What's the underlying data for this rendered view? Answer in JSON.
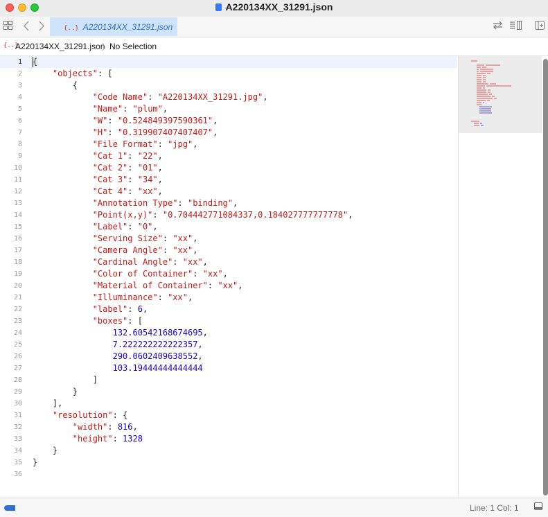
{
  "window": {
    "title": "A220134XX_31291.json"
  },
  "toolbar": {
    "grid_icon": "grid-icon",
    "back_icon": "chevron-left-icon",
    "forward_icon": "chevron-right-icon",
    "right_icons": [
      "swap-icon",
      "list-icon",
      "add-editor-icon"
    ]
  },
  "tabs": [
    {
      "badge": "{..}",
      "label": "A220134XX_31291.json",
      "active": true
    }
  ],
  "jumpbar": {
    "badge": "{..}",
    "file": "A220134XX_31291.json",
    "separator": "〉",
    "selection": "No Selection"
  },
  "editor": {
    "lines": [
      [
        [
          "p",
          "{"
        ]
      ],
      [
        [
          "p",
          "    "
        ],
        [
          "k",
          "\"objects\""
        ],
        [
          "p",
          ": ["
        ]
      ],
      [
        [
          "p",
          "        {"
        ]
      ],
      [
        [
          "p",
          "            "
        ],
        [
          "k",
          "\"Code Name\""
        ],
        [
          "p",
          ": "
        ],
        [
          "s",
          "\"A220134XX_31291.jpg\""
        ],
        [
          "p",
          ","
        ]
      ],
      [
        [
          "p",
          "            "
        ],
        [
          "k",
          "\"Name\""
        ],
        [
          "p",
          ": "
        ],
        [
          "s",
          "\"plum\""
        ],
        [
          "p",
          ","
        ]
      ],
      [
        [
          "p",
          "            "
        ],
        [
          "k",
          "\"W\""
        ],
        [
          "p",
          ": "
        ],
        [
          "s",
          "\"0.524849397590361\""
        ],
        [
          "p",
          ","
        ]
      ],
      [
        [
          "p",
          "            "
        ],
        [
          "k",
          "\"H\""
        ],
        [
          "p",
          ": "
        ],
        [
          "s",
          "\"0.319907407407407\""
        ],
        [
          "p",
          ","
        ]
      ],
      [
        [
          "p",
          "            "
        ],
        [
          "k",
          "\"File Format\""
        ],
        [
          "p",
          ": "
        ],
        [
          "s",
          "\"jpg\""
        ],
        [
          "p",
          ","
        ]
      ],
      [
        [
          "p",
          "            "
        ],
        [
          "k",
          "\"Cat 1\""
        ],
        [
          "p",
          ": "
        ],
        [
          "s",
          "\"22\""
        ],
        [
          "p",
          ","
        ]
      ],
      [
        [
          "p",
          "            "
        ],
        [
          "k",
          "\"Cat 2\""
        ],
        [
          "p",
          ": "
        ],
        [
          "s",
          "\"01\""
        ],
        [
          "p",
          ","
        ]
      ],
      [
        [
          "p",
          "            "
        ],
        [
          "k",
          "\"Cat 3\""
        ],
        [
          "p",
          ": "
        ],
        [
          "s",
          "\"34\""
        ],
        [
          "p",
          ","
        ]
      ],
      [
        [
          "p",
          "            "
        ],
        [
          "k",
          "\"Cat 4\""
        ],
        [
          "p",
          ": "
        ],
        [
          "s",
          "\"xx\""
        ],
        [
          "p",
          ","
        ]
      ],
      [
        [
          "p",
          "            "
        ],
        [
          "k",
          "\"Annotation Type\""
        ],
        [
          "p",
          ": "
        ],
        [
          "s",
          "\"binding\""
        ],
        [
          "p",
          ","
        ]
      ],
      [
        [
          "p",
          "            "
        ],
        [
          "k",
          "\"Point(x,y)\""
        ],
        [
          "p",
          ": "
        ],
        [
          "s",
          "\"0.704442771084337,0.184027777777778\""
        ],
        [
          "p",
          ","
        ]
      ],
      [
        [
          "p",
          "            "
        ],
        [
          "k",
          "\"Label\""
        ],
        [
          "p",
          ": "
        ],
        [
          "s",
          "\"0\""
        ],
        [
          "p",
          ","
        ]
      ],
      [
        [
          "p",
          "            "
        ],
        [
          "k",
          "\"Serving Size\""
        ],
        [
          "p",
          ": "
        ],
        [
          "s",
          "\"xx\""
        ],
        [
          "p",
          ","
        ]
      ],
      [
        [
          "p",
          "            "
        ],
        [
          "k",
          "\"Camera Angle\""
        ],
        [
          "p",
          ": "
        ],
        [
          "s",
          "\"xx\""
        ],
        [
          "p",
          ","
        ]
      ],
      [
        [
          "p",
          "            "
        ],
        [
          "k",
          "\"Cardinal Angle\""
        ],
        [
          "p",
          ": "
        ],
        [
          "s",
          "\"xx\""
        ],
        [
          "p",
          ","
        ]
      ],
      [
        [
          "p",
          "            "
        ],
        [
          "k",
          "\"Color of Container\""
        ],
        [
          "p",
          ": "
        ],
        [
          "s",
          "\"xx\""
        ],
        [
          "p",
          ","
        ]
      ],
      [
        [
          "p",
          "            "
        ],
        [
          "k",
          "\"Material of Container\""
        ],
        [
          "p",
          ": "
        ],
        [
          "s",
          "\"xx\""
        ],
        [
          "p",
          ","
        ]
      ],
      [
        [
          "p",
          "            "
        ],
        [
          "k",
          "\"Illuminance\""
        ],
        [
          "p",
          ": "
        ],
        [
          "s",
          "\"xx\""
        ],
        [
          "p",
          ","
        ]
      ],
      [
        [
          "p",
          "            "
        ],
        [
          "k",
          "\"label\""
        ],
        [
          "p",
          ": "
        ],
        [
          "n",
          "6"
        ],
        [
          "p",
          ","
        ]
      ],
      [
        [
          "p",
          "            "
        ],
        [
          "k",
          "\"boxes\""
        ],
        [
          "p",
          ": ["
        ]
      ],
      [
        [
          "p",
          "                "
        ],
        [
          "n",
          "132.60542168674695"
        ],
        [
          "p",
          ","
        ]
      ],
      [
        [
          "p",
          "                "
        ],
        [
          "n",
          "7.222222222222357"
        ],
        [
          "p",
          ","
        ]
      ],
      [
        [
          "p",
          "                "
        ],
        [
          "n",
          "290.0602409638552"
        ],
        [
          "p",
          ","
        ]
      ],
      [
        [
          "p",
          "                "
        ],
        [
          "n",
          "103.19444444444444"
        ]
      ],
      [
        [
          "p",
          "            ]"
        ]
      ],
      [
        [
          "p",
          "        }"
        ]
      ],
      [
        [
          "p",
          "    ],"
        ]
      ],
      [
        [
          "p",
          "    "
        ],
        [
          "k",
          "\"resolution\""
        ],
        [
          "p",
          ": {"
        ]
      ],
      [
        [
          "p",
          "        "
        ],
        [
          "k",
          "\"width\""
        ],
        [
          "p",
          ": "
        ],
        [
          "n",
          "816"
        ],
        [
          "p",
          ","
        ]
      ],
      [
        [
          "p",
          "        "
        ],
        [
          "k",
          "\"height\""
        ],
        [
          "p",
          ": "
        ],
        [
          "n",
          "1328"
        ]
      ],
      [
        [
          "p",
          "    }"
        ]
      ],
      [
        [
          "p",
          "}"
        ]
      ],
      [
        [
          "p",
          ""
        ]
      ]
    ],
    "line_numbers": [
      "1",
      "2",
      "3",
      "4",
      "5",
      "6",
      "7",
      "8",
      "9",
      "10",
      "11",
      "12",
      "13",
      "14",
      "15",
      "16",
      "17",
      "18",
      "19",
      "20",
      "21",
      "22",
      "23",
      "24",
      "25",
      "26",
      "27",
      "28",
      "29",
      "30",
      "31",
      "32",
      "33",
      "34",
      "35",
      "36"
    ],
    "active_line": 1
  },
  "colors": {
    "key": "#c41a16",
    "string": "#c41a16",
    "number": "#1c00cf",
    "accent": "#2f6fd6"
  },
  "status": {
    "position": "Line: 1  Col: 1",
    "panel_icon": "bottom-panel-icon"
  }
}
